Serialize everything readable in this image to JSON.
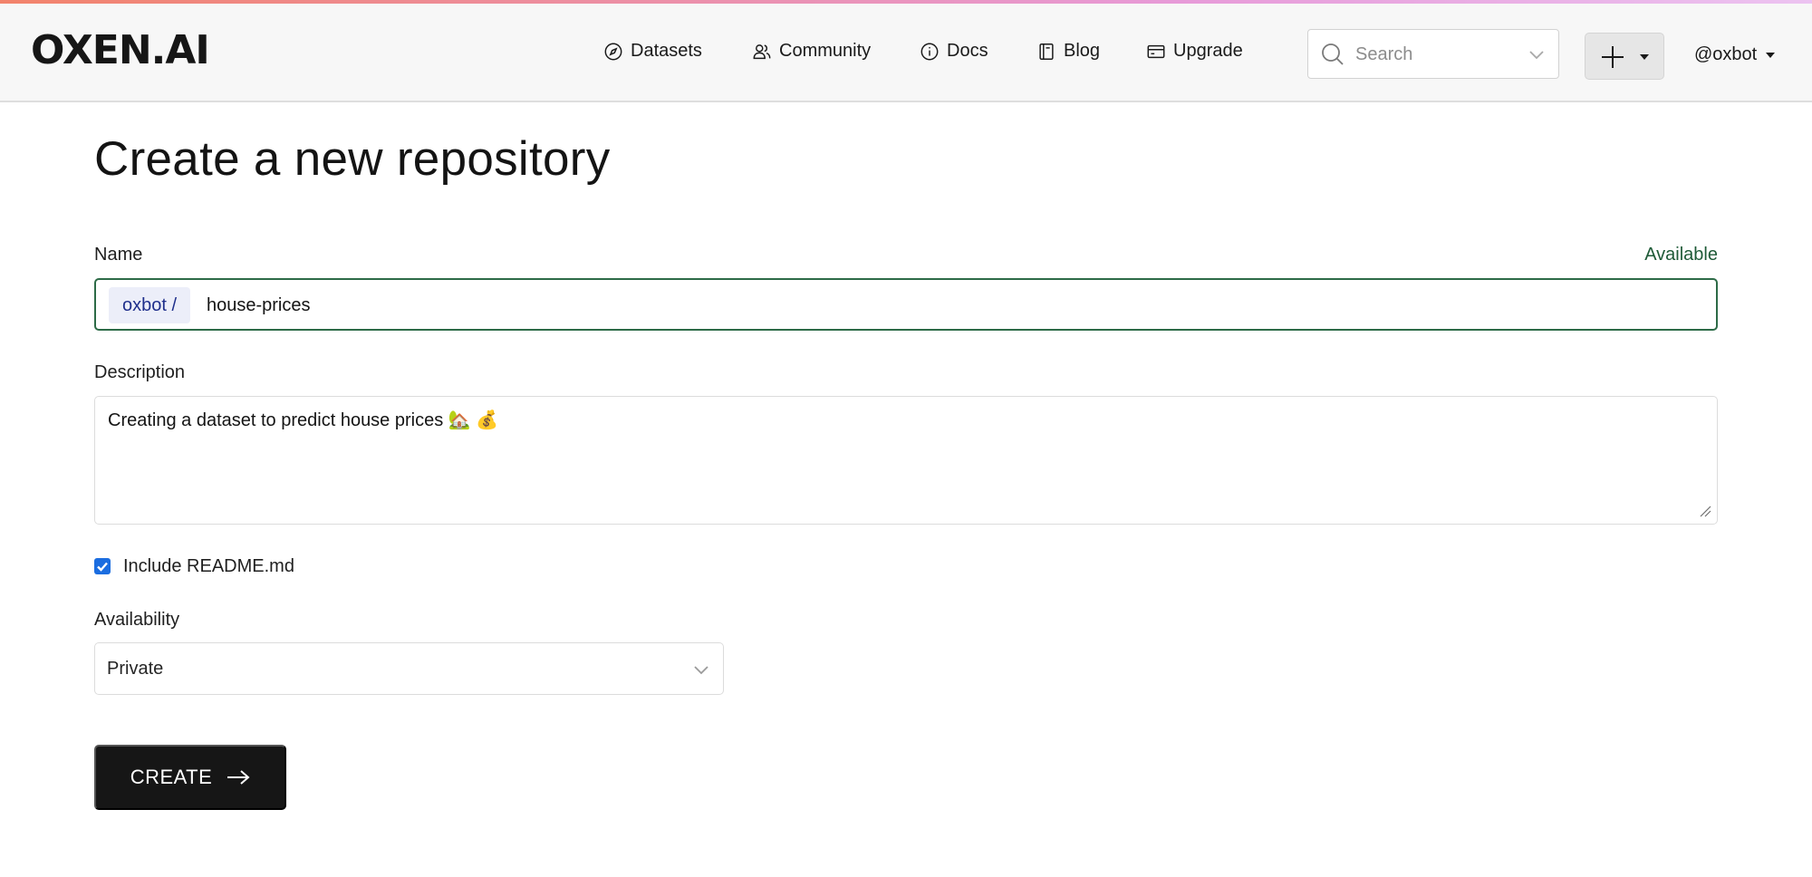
{
  "app": {
    "logo_text": "OXEN.AI"
  },
  "nav": {
    "items": [
      {
        "label": "Datasets",
        "icon": "compass-icon"
      },
      {
        "label": "Community",
        "icon": "users-icon"
      },
      {
        "label": "Docs",
        "icon": "info-circle-icon"
      },
      {
        "label": "Blog",
        "icon": "book-icon"
      },
      {
        "label": "Upgrade",
        "icon": "credit-card-icon"
      }
    ]
  },
  "search": {
    "placeholder": "Search",
    "value": ""
  },
  "user": {
    "handle": "@oxbot"
  },
  "page": {
    "title": "Create a new repository"
  },
  "form": {
    "name_label": "Name",
    "name_status": "Available",
    "name_prefix": "oxbot /",
    "name_value": "house-prices",
    "description_label": "Description",
    "description_value": "Creating a dataset to predict house prices 🏡 💰",
    "readme_label": "Include README.md",
    "readme_checked": true,
    "availability_label": "Availability",
    "availability_value": "Private",
    "create_label": "CREATE"
  },
  "colors": {
    "accent_gradient": [
      "#f2836b",
      "#ec8fa6",
      "#e79ad8",
      "#ecc3f1"
    ],
    "available_green": "#1e5a37",
    "prefix_bg": "#eceef9",
    "prefix_text": "#1f2f8c",
    "checkbox_blue": "#1b6de0",
    "button_bg": "#161616"
  }
}
